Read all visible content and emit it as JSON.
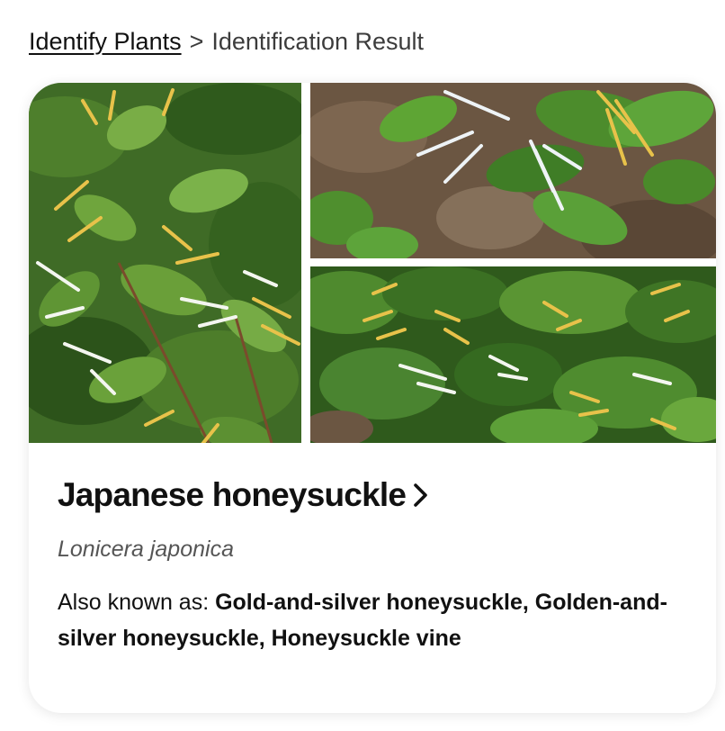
{
  "breadcrumb": {
    "parent_label": "Identify Plants",
    "separator": ">",
    "current_label": "Identification Result"
  },
  "result": {
    "common_name": "Japanese honeysuckle",
    "scientific_name": "Lonicera japonica",
    "aka_label": "Also known as:",
    "aka_values": "Gold-and-silver honeysuckle, Golden-and-silver honeysuckle, Honeysuckle vine",
    "chevron_icon": "chevron-right-icon"
  },
  "gallery": {
    "photos": [
      {
        "name": "plant-photo-1"
      },
      {
        "name": "plant-photo-2"
      },
      {
        "name": "plant-photo-3"
      }
    ]
  },
  "colors": {
    "leaf_dark": "#2f5a1c",
    "leaf_light": "#6fa53d",
    "flower_white": "#f4f6f0",
    "flower_yellow": "#e8c24a",
    "ground_brown": "#6b5642"
  }
}
